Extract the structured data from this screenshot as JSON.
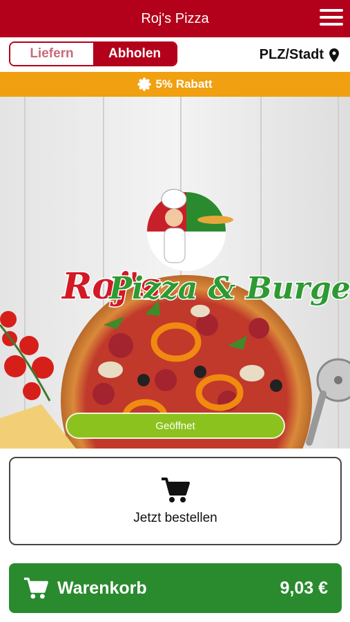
{
  "header": {
    "title": "Roj's Pizza",
    "menu_icon": "hamburger-menu-icon"
  },
  "mode": {
    "deliver_label": "Liefern",
    "pickup_label": "Abholen",
    "selected": "Abholen"
  },
  "location": {
    "label": "PLZ/Stadt",
    "icon": "location-pin-icon"
  },
  "discount": {
    "label": "5% Rabatt",
    "icon": "badge-icon"
  },
  "hero": {
    "logo_text_1": "Roj's",
    "logo_text_2": "Pizza & Burger",
    "status_label": "Geöffnet"
  },
  "order": {
    "label": "Jetzt bestellen",
    "icon": "cart-icon"
  },
  "cart": {
    "label": "Warenkorb",
    "amount": "9,03 €",
    "icon": "cart-icon"
  },
  "colors": {
    "primary": "#b3001b",
    "discount": "#f0a010",
    "open": "#8cc21e",
    "cart": "#2a8a2e"
  }
}
